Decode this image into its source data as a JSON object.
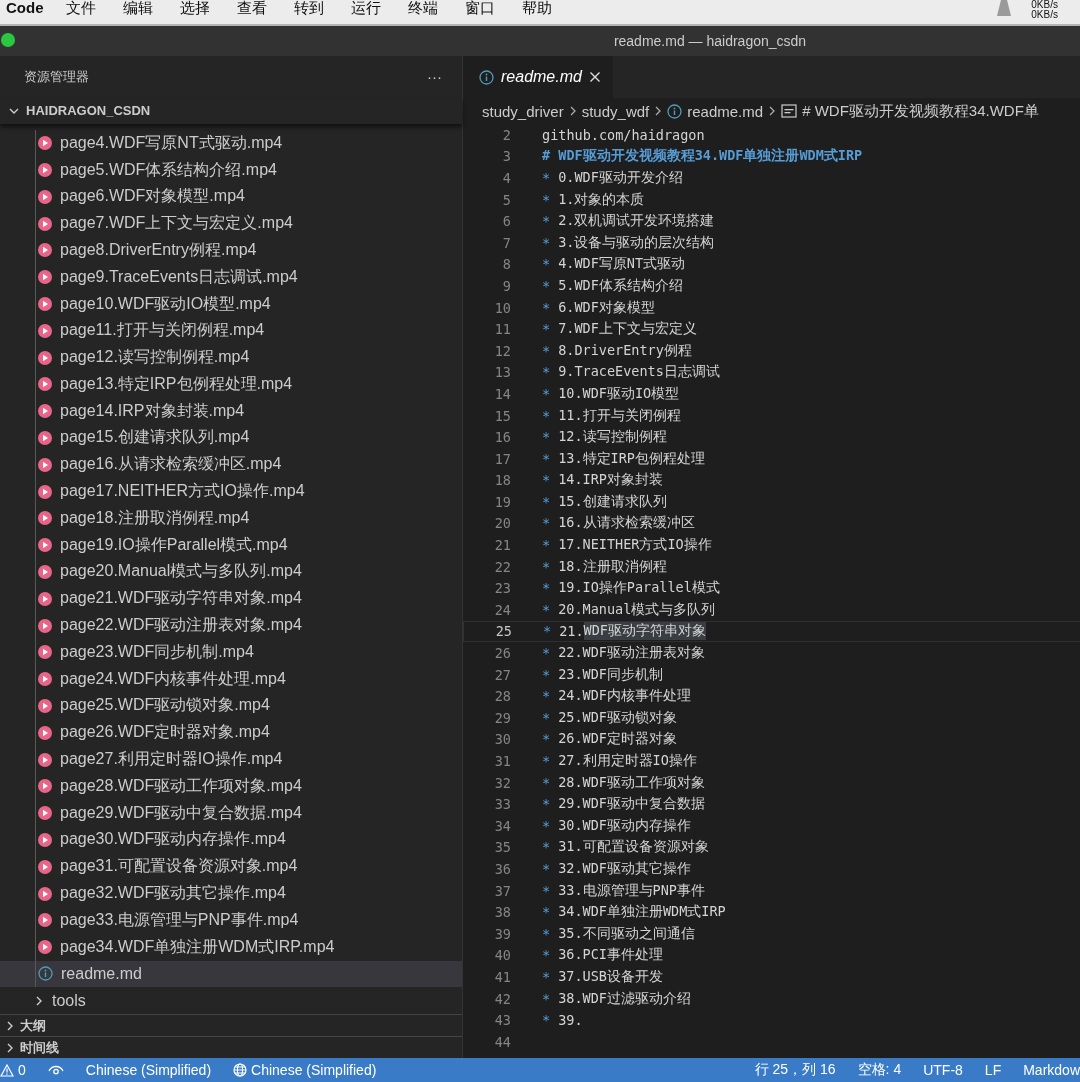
{
  "menu_bar": {
    "app": "Code",
    "items": [
      "文件",
      "编辑",
      "选择",
      "查看",
      "转到",
      "运行",
      "终端",
      "窗口",
      "帮助"
    ],
    "net_speeds": [
      "0KB/s",
      "0KB/s"
    ]
  },
  "window": {
    "title": "readme.md — haidragon_csdn"
  },
  "sidebar": {
    "title": "资源管理器",
    "more": "···",
    "folder": {
      "label": "HAIDRAGON_CSDN",
      "expanded": true
    },
    "files": [
      {
        "kind": "video",
        "label": "page4.WDF写原NT式驱动.mp4",
        "selected": false
      },
      {
        "kind": "video",
        "label": "page5.WDF体系结构介绍.mp4",
        "selected": false
      },
      {
        "kind": "video",
        "label": "page6.WDF对象模型.mp4",
        "selected": false
      },
      {
        "kind": "video",
        "label": "page7.WDF上下文与宏定义.mp4",
        "selected": false
      },
      {
        "kind": "video",
        "label": "page8.DriverEntry例程.mp4",
        "selected": false
      },
      {
        "kind": "video",
        "label": "page9.TraceEvents日志调试.mp4",
        "selected": false
      },
      {
        "kind": "video",
        "label": "page10.WDF驱动IO模型.mp4",
        "selected": false
      },
      {
        "kind": "video",
        "label": "page11.打开与关闭例程.mp4",
        "selected": false
      },
      {
        "kind": "video",
        "label": "page12.读写控制例程.mp4",
        "selected": false
      },
      {
        "kind": "video",
        "label": "page13.特定IRP包例程处理.mp4",
        "selected": false
      },
      {
        "kind": "video",
        "label": "page14.IRP对象封装.mp4",
        "selected": false
      },
      {
        "kind": "video",
        "label": "page15.创建请求队列.mp4",
        "selected": false
      },
      {
        "kind": "video",
        "label": "page16.从请求检索缓冲区.mp4",
        "selected": false
      },
      {
        "kind": "video",
        "label": "page17.NEITHER方式IO操作.mp4",
        "selected": false
      },
      {
        "kind": "video",
        "label": "page18.注册取消例程.mp4",
        "selected": false
      },
      {
        "kind": "video",
        "label": "page19.IO操作Parallel模式.mp4",
        "selected": false
      },
      {
        "kind": "video",
        "label": "page20.Manual模式与多队列.mp4",
        "selected": false
      },
      {
        "kind": "video",
        "label": "page21.WDF驱动字符串对象.mp4",
        "selected": false
      },
      {
        "kind": "video",
        "label": "page22.WDF驱动注册表对象.mp4",
        "selected": false
      },
      {
        "kind": "video",
        "label": "page23.WDF同步机制.mp4",
        "selected": false
      },
      {
        "kind": "video",
        "label": "page24.WDF内核事件处理.mp4",
        "selected": false
      },
      {
        "kind": "video",
        "label": "page25.WDF驱动锁对象.mp4",
        "selected": false
      },
      {
        "kind": "video",
        "label": "page26.WDF定时器对象.mp4",
        "selected": false
      },
      {
        "kind": "video",
        "label": "page27.利用定时器IO操作.mp4",
        "selected": false
      },
      {
        "kind": "video",
        "label": "page28.WDF驱动工作项对象.mp4",
        "selected": false
      },
      {
        "kind": "video",
        "label": "page29.WDF驱动中复合数据.mp4",
        "selected": false
      },
      {
        "kind": "video",
        "label": "page30.WDF驱动内存操作.mp4",
        "selected": false
      },
      {
        "kind": "video",
        "label": "page31.可配置设备资源对象.mp4",
        "selected": false
      },
      {
        "kind": "video",
        "label": "page32.WDF驱动其它操作.mp4",
        "selected": false
      },
      {
        "kind": "video",
        "label": "page33.电源管理与PNP事件.mp4",
        "selected": false
      },
      {
        "kind": "video",
        "label": "page34.WDF单独注册WDM式IRP.mp4",
        "selected": false
      },
      {
        "kind": "markdown",
        "label": "readme.md",
        "selected": true
      },
      {
        "kind": "folder",
        "label": "tools",
        "selected": false
      }
    ],
    "sections": [
      {
        "label": "大纲",
        "expanded": false
      },
      {
        "label": "时间线",
        "expanded": false
      }
    ]
  },
  "tab": {
    "label": "readme.md"
  },
  "breadcrumb": [
    {
      "kind": "folder",
      "label": "study_driver"
    },
    {
      "kind": "folder",
      "label": "study_wdf"
    },
    {
      "kind": "file",
      "label": "readme.md"
    },
    {
      "kind": "symbol",
      "label": "# WDF驱动开发视频教程34.WDF单"
    }
  ],
  "lines": [
    {
      "no": "2",
      "kind": "url",
      "text": "github.com/haidragon",
      "current": false
    },
    {
      "no": "3",
      "kind": "heading",
      "text": "# WDF驱动开发视频教程34.WDF单独注册WDM式IRP",
      "current": false
    },
    {
      "no": "4",
      "kind": "bullet",
      "marker": "*",
      "text": "0.WDF驱动开发介绍",
      "current": false
    },
    {
      "no": "5",
      "kind": "bullet",
      "marker": "*",
      "text": "1.对象的本质",
      "current": false
    },
    {
      "no": "6",
      "kind": "bullet",
      "marker": "*",
      "text": "2.双机调试开发环境搭建",
      "current": false
    },
    {
      "no": "7",
      "kind": "bullet",
      "marker": "*",
      "text": "3.设备与驱动的层次结构",
      "current": false
    },
    {
      "no": "8",
      "kind": "bullet",
      "marker": "*",
      "text": "4.WDF写原NT式驱动",
      "current": false
    },
    {
      "no": "9",
      "kind": "bullet",
      "marker": "*",
      "text": "5.WDF体系结构介绍",
      "current": false
    },
    {
      "no": "10",
      "kind": "bullet",
      "marker": "*",
      "text": "6.WDF对象模型",
      "current": false
    },
    {
      "no": "11",
      "kind": "bullet",
      "marker": "*",
      "text": "7.WDF上下文与宏定义",
      "current": false
    },
    {
      "no": "12",
      "kind": "bullet",
      "marker": "*",
      "text": "8.DriverEntry例程",
      "current": false
    },
    {
      "no": "13",
      "kind": "bullet",
      "marker": "*",
      "text": "9.TraceEvents日志调试",
      "current": false
    },
    {
      "no": "14",
      "kind": "bullet",
      "marker": "*",
      "text": "10.WDF驱动IO模型",
      "current": false
    },
    {
      "no": "15",
      "kind": "bullet",
      "marker": "*",
      "text": "11.打开与关闭例程",
      "current": false
    },
    {
      "no": "16",
      "kind": "bullet",
      "marker": "*",
      "text": "12.读写控制例程",
      "current": false
    },
    {
      "no": "17",
      "kind": "bullet",
      "marker": "*",
      "text": "13.特定IRP包例程处理",
      "current": false
    },
    {
      "no": "18",
      "kind": "bullet",
      "marker": "*",
      "text": "14.IRP对象封装",
      "current": false
    },
    {
      "no": "19",
      "kind": "bullet",
      "marker": "*",
      "text": "15.创建请求队列",
      "current": false
    },
    {
      "no": "20",
      "kind": "bullet",
      "marker": "*",
      "text": "16.从请求检索缓冲区",
      "current": false
    },
    {
      "no": "21",
      "kind": "bullet",
      "marker": "*",
      "text": "17.NEITHER方式IO操作",
      "current": false
    },
    {
      "no": "22",
      "kind": "bullet",
      "marker": "*",
      "text": "18.注册取消例程",
      "current": false
    },
    {
      "no": "23",
      "kind": "bullet",
      "marker": "*",
      "text": "19.IO操作Parallel模式",
      "current": false
    },
    {
      "no": "24",
      "kind": "bullet",
      "marker": "*",
      "text": "20.Manual模式与多队列",
      "current": false
    },
    {
      "no": "25",
      "kind": "bullet",
      "marker": "*",
      "text": "21.",
      "highlight": "WDF驱动字符串对象",
      "current": true
    },
    {
      "no": "26",
      "kind": "bullet",
      "marker": "*",
      "text": "22.WDF驱动注册表对象",
      "current": false
    },
    {
      "no": "27",
      "kind": "bullet",
      "marker": "*",
      "text": "23.WDF同步机制",
      "current": false
    },
    {
      "no": "28",
      "kind": "bullet",
      "marker": "*",
      "text": "24.WDF内核事件处理",
      "current": false
    },
    {
      "no": "29",
      "kind": "bullet",
      "marker": "*",
      "text": "25.WDF驱动锁对象",
      "current": false
    },
    {
      "no": "30",
      "kind": "bullet",
      "marker": "*",
      "text": "26.WDF定时器对象",
      "current": false
    },
    {
      "no": "31",
      "kind": "bullet",
      "marker": "*",
      "text": "27.利用定时器IO操作",
      "current": false
    },
    {
      "no": "32",
      "kind": "bullet",
      "marker": "*",
      "text": "28.WDF驱动工作项对象",
      "current": false
    },
    {
      "no": "33",
      "kind": "bullet",
      "marker": "*",
      "text": "29.WDF驱动中复合数据",
      "current": false
    },
    {
      "no": "34",
      "kind": "bullet",
      "marker": "*",
      "text": "30.WDF驱动内存操作",
      "current": false
    },
    {
      "no": "35",
      "kind": "bullet",
      "marker": "*",
      "text": "31.可配置设备资源对象",
      "current": false
    },
    {
      "no": "36",
      "kind": "bullet",
      "marker": "*",
      "text": "32.WDF驱动其它操作",
      "current": false
    },
    {
      "no": "37",
      "kind": "bullet",
      "marker": "*",
      "text": "33.电源管理与PNP事件",
      "current": false
    },
    {
      "no": "38",
      "kind": "bullet",
      "marker": "*",
      "text": "34.WDF单独注册WDM式IRP",
      "current": false
    },
    {
      "no": "39",
      "kind": "bullet",
      "marker": "*",
      "text": "35.不同驱动之间通信",
      "current": false
    },
    {
      "no": "40",
      "kind": "bullet",
      "marker": "*",
      "text": "36.PCI事件处理",
      "current": false
    },
    {
      "no": "41",
      "kind": "bullet",
      "marker": "*",
      "text": "37.USB设备开发",
      "current": false
    },
    {
      "no": "42",
      "kind": "bullet",
      "marker": "*",
      "text": "38.WDF过滤驱动介绍",
      "current": false
    },
    {
      "no": "43",
      "kind": "bullet",
      "marker": "*",
      "text": "39.",
      "current": false
    },
    {
      "no": "44",
      "kind": "empty",
      "current": false
    }
  ],
  "status_bar": {
    "problems": "0",
    "language_left": "Chinese (Simplified)",
    "language_right": "Chinese (Simplified)",
    "position": "行 25，列 16",
    "indent": "空格: 4",
    "encoding": "UTF-8",
    "eol": "LF",
    "mode": "Markdow"
  }
}
